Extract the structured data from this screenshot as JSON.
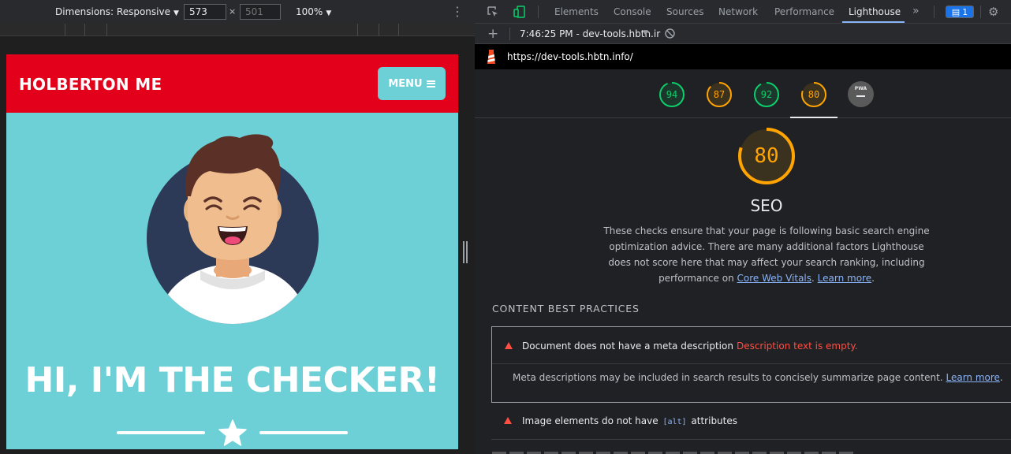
{
  "device_toolbar": {
    "dimensions_label": "Dimensions: Responsive",
    "width_value": "573",
    "times": "×",
    "height_placeholder": "501",
    "zoom": "100%"
  },
  "site": {
    "brand": "HOLBERTON ME",
    "menu_label": "MENU",
    "hero_title": "HI, I'M THE CHECKER!",
    "colors": {
      "nav": "#e3001b",
      "hero": "#6dd0d6"
    }
  },
  "devtools": {
    "tabs": [
      "Elements",
      "Console",
      "Sources",
      "Network",
      "Performance",
      "Lighthouse"
    ],
    "more_tabs": "»",
    "issues_count": "1",
    "report_label": "7:46:25 PM - dev-tools.hbtn.ir",
    "url": "https://dev-tools.hbtn.info/",
    "scores": [
      {
        "value": "94",
        "color": "#0cce6b"
      },
      {
        "value": "87",
        "color": "#ffa400"
      },
      {
        "value": "92",
        "color": "#0cce6b"
      },
      {
        "value": "80",
        "color": "#ffa400"
      }
    ],
    "pwa_label": "PWA",
    "seo": {
      "score": "80",
      "score_fraction": 0.8,
      "title": "SEO",
      "description": "These checks ensure that your page is following basic search engine optimization advice. There are many additional factors Lighthouse does not score here that may affect your search ranking, including performance on",
      "link_cwv": "Core Web Vitals",
      "link_sep": ".",
      "link_learn": "Learn more",
      "link_end": "."
    },
    "section_title": "CONTENT BEST PRACTICES",
    "audit1": {
      "title": "Document does not have a meta description",
      "error": "Description text is empty.",
      "body": "Meta descriptions may be included in search results to concisely summarize page content.",
      "link": "Learn more",
      "link_end": "."
    },
    "audit2": {
      "title_pre": "Image elements do not have",
      "code": "[alt]",
      "title_post": "attributes"
    }
  }
}
